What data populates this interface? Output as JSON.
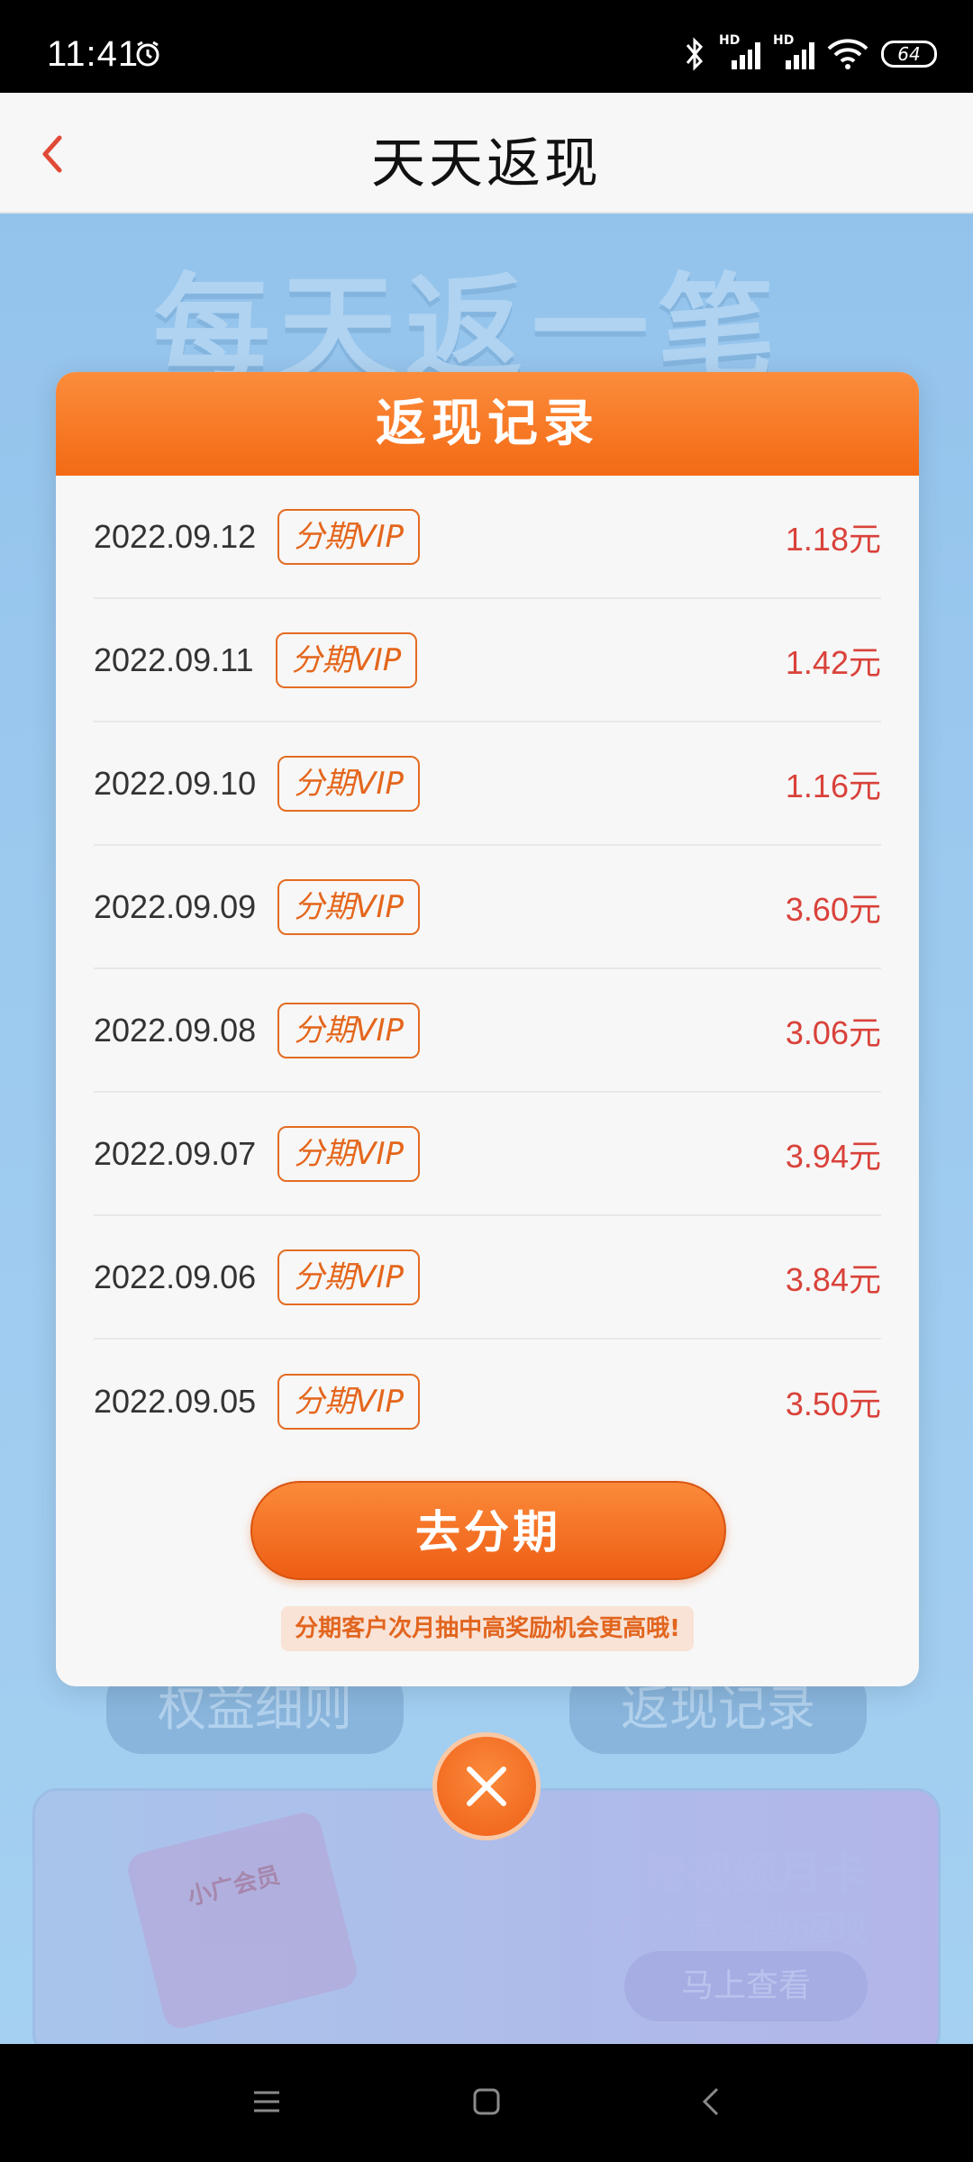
{
  "status_bar": {
    "time": "11:41",
    "hd1": "HD",
    "hd2": "HD",
    "battery": "64"
  },
  "nav": {
    "title": "天天返现"
  },
  "background": {
    "headline": "每天返一笔",
    "btn_rules": "权益细则",
    "btn_records": "返现记录",
    "banner": {
      "image_label": "小广会员",
      "title": "赠视频月卡",
      "subtitle": "小广会员 分期返现",
      "button": "马上查看"
    }
  },
  "modal": {
    "title": "返现记录",
    "records": [
      {
        "date": "2022.09.12",
        "tag": "分期VIP",
        "amount": "1.18",
        "unit": "元"
      },
      {
        "date": "2022.09.11",
        "tag": "分期VIP",
        "amount": "1.42",
        "unit": "元"
      },
      {
        "date": "2022.09.10",
        "tag": "分期VIP",
        "amount": "1.16",
        "unit": "元"
      },
      {
        "date": "2022.09.09",
        "tag": "分期VIP",
        "amount": "3.60",
        "unit": "元"
      },
      {
        "date": "2022.09.08",
        "tag": "分期VIP",
        "amount": "3.06",
        "unit": "元"
      },
      {
        "date": "2022.09.07",
        "tag": "分期VIP",
        "amount": "3.94",
        "unit": "元"
      },
      {
        "date": "2022.09.06",
        "tag": "分期VIP",
        "amount": "3.84",
        "unit": "元"
      },
      {
        "date": "2022.09.05",
        "tag": "分期VIP",
        "amount": "3.50",
        "unit": "元"
      }
    ],
    "go_button": "去分期",
    "hint": "分期客户次月抽中高奖励机会更高哦!"
  },
  "colors": {
    "accent": "#f46a14",
    "amount": "#d9423a",
    "background": "#a9d4f6"
  },
  "icons": {
    "back": "chevron-left-icon",
    "close": "close-icon",
    "alarm": "alarm-icon",
    "bluetooth": "bluetooth-icon",
    "wifi": "wifi-icon"
  }
}
